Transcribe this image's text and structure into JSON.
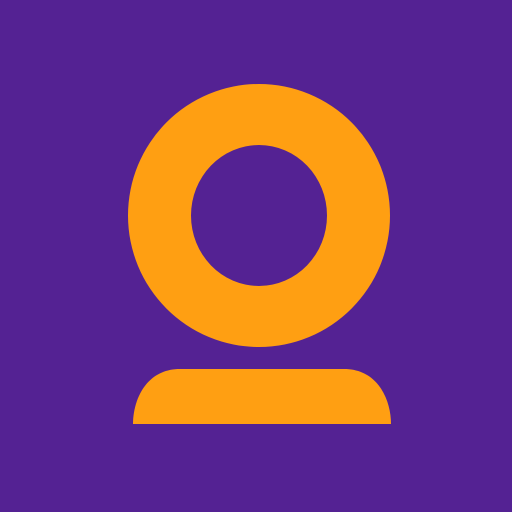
{
  "icon": {
    "name": "person-profile-icon",
    "colors": {
      "background": "#542293",
      "glyph": "#FF9F12"
    }
  }
}
